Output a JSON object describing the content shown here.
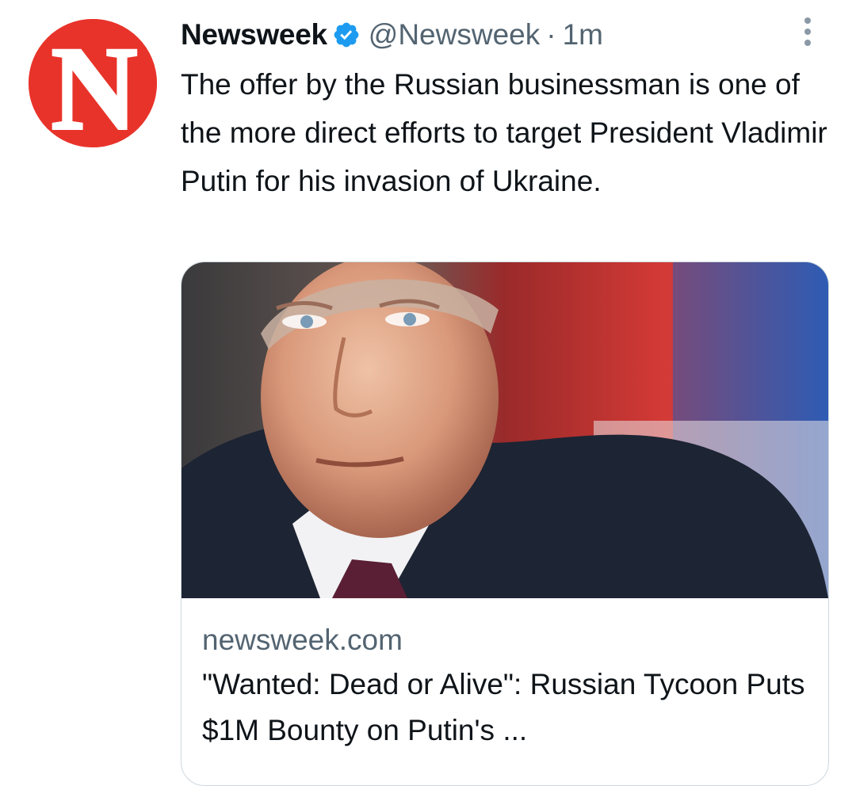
{
  "tweet": {
    "author": {
      "display_name": "Newsweek",
      "handle": "@Newsweek",
      "avatar_letter": "N",
      "verified": true
    },
    "separator": "·",
    "timestamp": "1m",
    "text": "The offer by the Russian businessman is one of the more direct efforts to target President Vladimir Putin for his invasion of Ukraine.",
    "card": {
      "domain": "newsweek.com",
      "title": "\"Wanted: Dead or Alive\": Russian Tycoon Puts $1M Bounty on Putin's ...",
      "image_icon": "photo-of-man-in-suit-icon"
    }
  },
  "icons": {
    "verified": "verified-badge-icon",
    "more": "more-options-icon"
  },
  "colors": {
    "brand_red": "#e8332a",
    "verified_blue": "#1d9bf0",
    "secondary_text": "#536471",
    "primary_text": "#0f1419",
    "border": "#cfd9de"
  }
}
